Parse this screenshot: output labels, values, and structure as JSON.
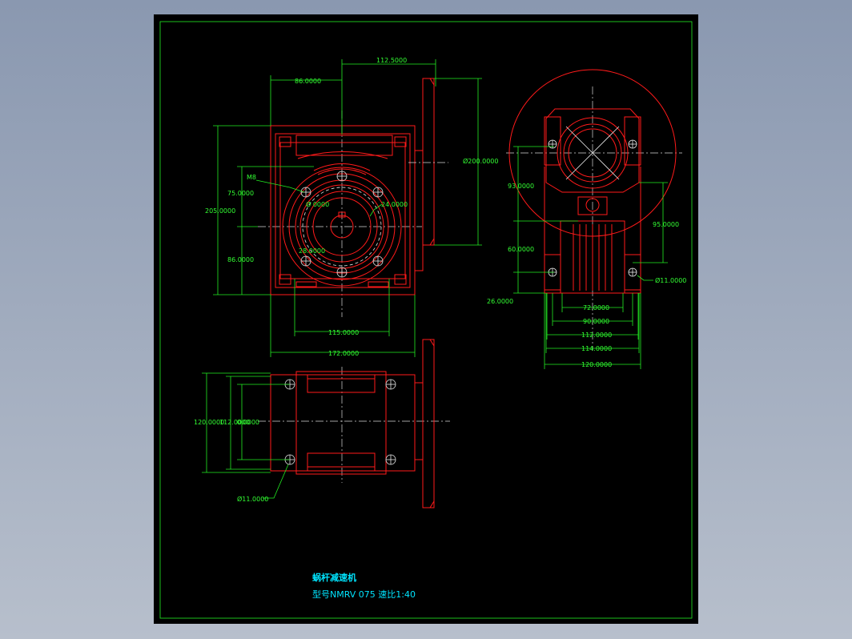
{
  "title_block": {
    "name": "蜗杆减速机",
    "model": "型号NMRV 075 速比1:40"
  },
  "dimensions": {
    "front_top_width": "112.5000",
    "front_left_offset": "86.0000",
    "front_flange_dia": "Ø200.0000",
    "front_height": "205.0000",
    "front_upper": "75.0000",
    "front_lower": "86.0000",
    "thread": "M8",
    "bore_small": "Ø 0000",
    "bore_right": "24.0000",
    "bore_bottom": "28.0000",
    "front_bottom_inner": "115.0000",
    "front_bottom_outer": "172.0000",
    "side_93": "93.0000",
    "side_95": "95.0000",
    "side_60": "60.0000",
    "side_26": "26.0000",
    "side_hole": "Ø11.0000",
    "side_72": "72.0000",
    "side_90": "90.0000",
    "side_112": "112.0000",
    "side_114": "114.0000",
    "side_120": "120.0000",
    "bottom_120": "120.0000",
    "bottom_112": "112.0000",
    "bottom_inner": "0.0000",
    "bottom_hole": "Ø11.0000"
  }
}
